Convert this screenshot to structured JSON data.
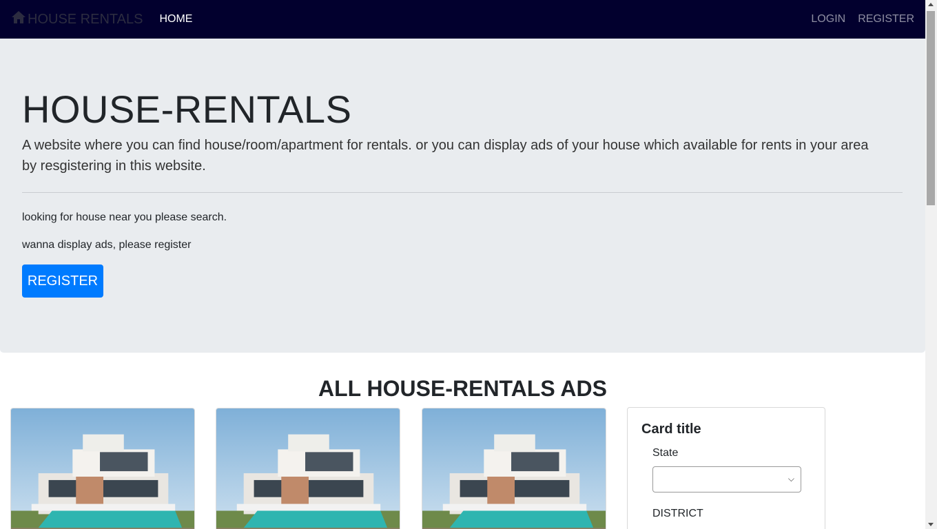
{
  "nav": {
    "brand": "HOUSE RENTALS",
    "home": "HOME",
    "login": "LOGIN",
    "register": "REGISTER"
  },
  "hero": {
    "title": "HOUSE-RENTALS",
    "lead": "A website where you can find house/room/apartment for rentals. or you can display ads of your house which available for rents in your area by resgistering in this website.",
    "line1": "looking for house near you please search.",
    "line2": "wanna display ads, please register",
    "button": "REGISTER"
  },
  "ads": {
    "heading": "ALL HOUSE-RENTALS ADS"
  },
  "filter": {
    "title": "Card title",
    "state_label": "State",
    "state_value": "",
    "district_label": "DISTRICT"
  },
  "colors": {
    "navbar": "#02002e",
    "jumbotron": "#e9ecef",
    "primary": "#007bff"
  }
}
